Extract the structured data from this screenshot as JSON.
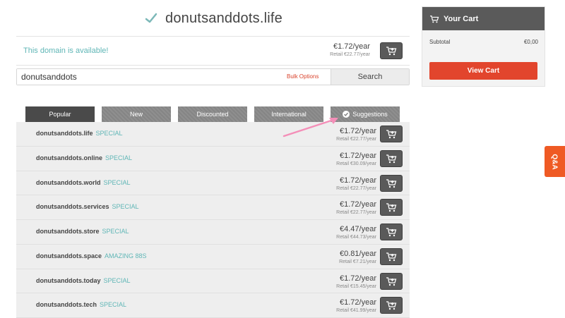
{
  "domain": {
    "name": "donutsanddots.life",
    "availability_text": "This domain is available!",
    "price": "€1.72/year",
    "retail": "Retail €22.77/year"
  },
  "search": {
    "value": "donutsanddots",
    "bulk_label": "Bulk Options",
    "button_label": "Search"
  },
  "tabs": [
    {
      "label": "Popular",
      "active": true
    },
    {
      "label": "New"
    },
    {
      "label": "Discounted"
    },
    {
      "label": "International"
    },
    {
      "label": "Suggestions"
    }
  ],
  "results": [
    {
      "domain": "donutsanddots.life",
      "tag": "SPECIAL",
      "price": "€1.72/year",
      "retail": "Retail €22.77/year"
    },
    {
      "domain": "donutsanddots.online",
      "tag": "SPECIAL",
      "price": "€1.72/year",
      "retail": "Retail €30.09/year"
    },
    {
      "domain": "donutsanddots.world",
      "tag": "SPECIAL",
      "price": "€1.72/year",
      "retail": "Retail €22.77/year"
    },
    {
      "domain": "donutsanddots.services",
      "tag": "SPECIAL",
      "price": "€1.72/year",
      "retail": "Retail €22.77/year"
    },
    {
      "domain": "donutsanddots.store",
      "tag": "SPECIAL",
      "price": "€4.47/year",
      "retail": "Retail €44.73/year"
    },
    {
      "domain": "donutsanddots.space",
      "tag": "AMAZING 88S",
      "price": "€0.81/year",
      "retail": "Retail €7.21/year"
    },
    {
      "domain": "donutsanddots.today",
      "tag": "SPECIAL",
      "price": "€1.72/year",
      "retail": "Retail €15.45/year"
    },
    {
      "domain": "donutsanddots.tech",
      "tag": "SPECIAL",
      "price": "€1.72/year",
      "retail": "Retail €41.99/year"
    }
  ],
  "cart": {
    "title": "Your Cart",
    "subtotal_label": "Subtotal",
    "subtotal_value": "€0,00",
    "view_cart_label": "View Cart"
  },
  "qa_label": "Q&A",
  "colors": {
    "accent": "#5fb6b6",
    "brand_orange": "#e2452d",
    "dark": "#5a5a5a",
    "arrow": "#f48fb8"
  },
  "icons": [
    "check-icon",
    "cart-icon",
    "arrow-annotation"
  ]
}
